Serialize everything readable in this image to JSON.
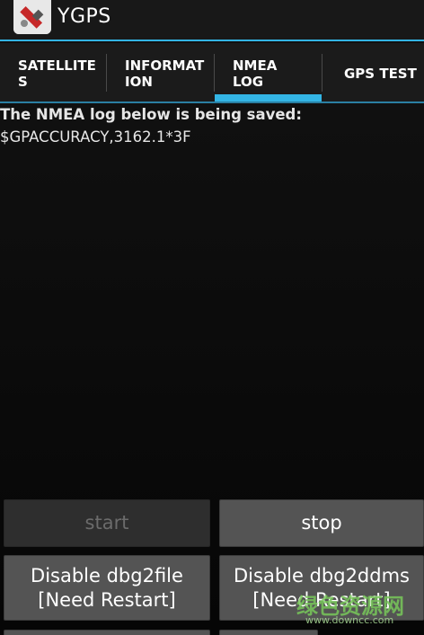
{
  "app": {
    "title": "YGPS",
    "icon": "satellite-app-icon"
  },
  "tabs": [
    {
      "label": "SATELLITES",
      "selected": false
    },
    {
      "label": "INFORMATION",
      "selected": false
    },
    {
      "label": "NMEA LOG",
      "selected": true
    },
    {
      "label": "GPS TEST",
      "selected": false
    }
  ],
  "nmea_log": {
    "heading": "The NMEA log below is being saved:",
    "lines": [
      "$GPACCURACY,3162.1*3F"
    ]
  },
  "buttons": {
    "start": {
      "label": "start",
      "enabled": false
    },
    "stop": {
      "label": "stop",
      "enabled": true
    },
    "disable_dbg2file": {
      "line1": "Disable dbg2file",
      "line2": "[Need Restart]"
    },
    "disable_dbg2ddms": {
      "line1": "Disable dbg2ddms",
      "line2": "[Need Restart]"
    }
  },
  "watermark": {
    "text": "绿色资源网",
    "url": "www.downcc.com"
  },
  "colors": {
    "accent": "#33b5e5",
    "background": "#0a0a0a",
    "button": "#545454",
    "button_disabled": "#2e2e2e"
  }
}
